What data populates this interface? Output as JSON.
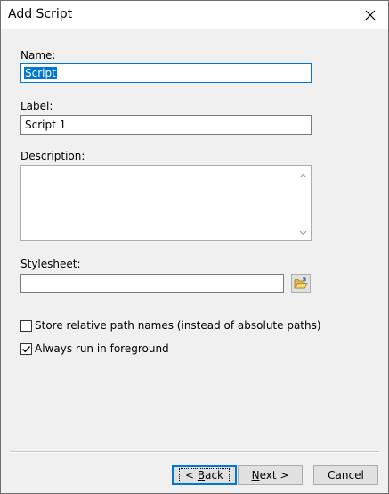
{
  "window": {
    "title": "Add Script"
  },
  "icons": {
    "close": "close-icon",
    "folder": "folder-open-icon",
    "scroll_up": "chevron-up-icon",
    "scroll_down": "chevron-down-icon",
    "check": "checkmark-icon"
  },
  "form": {
    "name_label": "Name:",
    "name_value": "Script",
    "label_label": "Label:",
    "label_value": "Script 1",
    "description_label": "Description:",
    "description_value": "",
    "stylesheet_label": "Stylesheet:",
    "stylesheet_value": ""
  },
  "options": {
    "relative_paths_label": "Store relative path names (instead of absolute paths)",
    "relative_paths_checked": false,
    "foreground_label": "Always run in foreground",
    "foreground_checked": true
  },
  "buttons": {
    "back_prefix": "< ",
    "back_key": "B",
    "back_rest": "ack",
    "next_key": "N",
    "next_rest": "ext >",
    "cancel": "Cancel"
  },
  "colors": {
    "accent": "#0078d7",
    "dialog_bg": "#f0f0f0"
  }
}
